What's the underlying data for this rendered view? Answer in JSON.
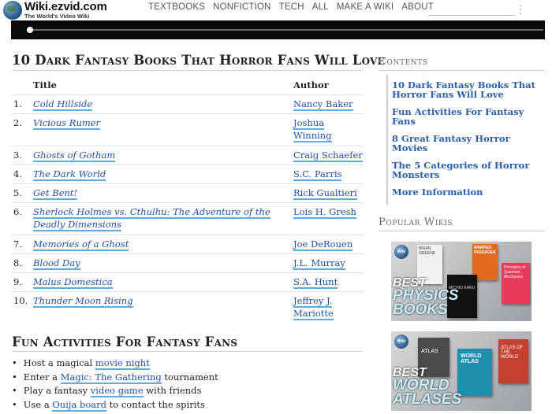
{
  "header": {
    "site_title": "Wiki.ezvid.com",
    "site_tagline": "The World's Video Wiki",
    "nav": [
      "TEXTBOOKS",
      "NONFICTION",
      "TECH",
      "ALL",
      "MAKE A WIKI",
      "ABOUT"
    ],
    "more_icon": "vertical-ellipsis-icon"
  },
  "main": {
    "title": "10 Dark Fantasy Books That Horror Fans Will Love",
    "table": {
      "headers": [
        "Title",
        "Author"
      ],
      "rows": [
        {
          "num": "1.",
          "title": "Cold Hillside",
          "author": "Nancy Baker"
        },
        {
          "num": "2.",
          "title": "Vicious Rumer",
          "author": "Joshua Winning"
        },
        {
          "num": "3.",
          "title": "Ghosts of Gotham",
          "author": "Craig Schaefer"
        },
        {
          "num": "4.",
          "title": "The Dark World",
          "author": "S.C. Parris"
        },
        {
          "num": "5.",
          "title": "Get Bent!",
          "author": "Rick Gualtieri"
        },
        {
          "num": "6.",
          "title": "Sherlock Holmes vs. Cthulhu: The Adventure of the Deadly Dimensions",
          "author": "Lois H. Gresh"
        },
        {
          "num": "7.",
          "title": "Memories of a Ghost",
          "author": "Joe DeRouen"
        },
        {
          "num": "8.",
          "title": "Blood Day",
          "author": "J.L. Murray"
        },
        {
          "num": "9.",
          "title": "Malus Domestica",
          "author": "S.A. Hunt"
        },
        {
          "num": "10.",
          "title": "Thunder Moon Rising",
          "author": "Jeffrey J. Mariotte"
        }
      ]
    },
    "fun_title": "Fun Activities For Fantasy Fans",
    "activities": [
      {
        "before": "Host a magical ",
        "link": "movie night",
        "after": ""
      },
      {
        "before": "Enter a ",
        "link": "Magic: The Gathering",
        "after": " tournament"
      },
      {
        "before": "Play a fantasy ",
        "link": "video game",
        "after": " with friends"
      },
      {
        "before": "Use a ",
        "link": "Ouija board",
        "after": " to contact the spirits"
      }
    ]
  },
  "sidebar": {
    "contents_title": "Contents",
    "contents": [
      "10 Dark Fantasy Books That Horror Fans Will Love",
      "Fun Activities For Fantasy Fans",
      "8 Great Fantasy Horror Movies",
      "The 5 Categories of Horror Monsters",
      "More Information"
    ],
    "popular_title": "Popular Wikis",
    "wikis": [
      {
        "badge": "Wiki",
        "l1": "BEST",
        "l2": "PHYSICS",
        "l3": "BOOKS",
        "covers": [
          "BRIAN GREENE",
          "WARPED PASSAGES",
          "MICHIO KAKU",
          "Principles of Quantum Mechanics"
        ]
      },
      {
        "badge": "Wiki",
        "l1": "BEST",
        "l2": "WORLD",
        "l3": "ATLASES",
        "covers": [
          "ATLAS",
          "WORLD ATLAS",
          "ATLAS OF THE WORLD"
        ]
      }
    ]
  }
}
